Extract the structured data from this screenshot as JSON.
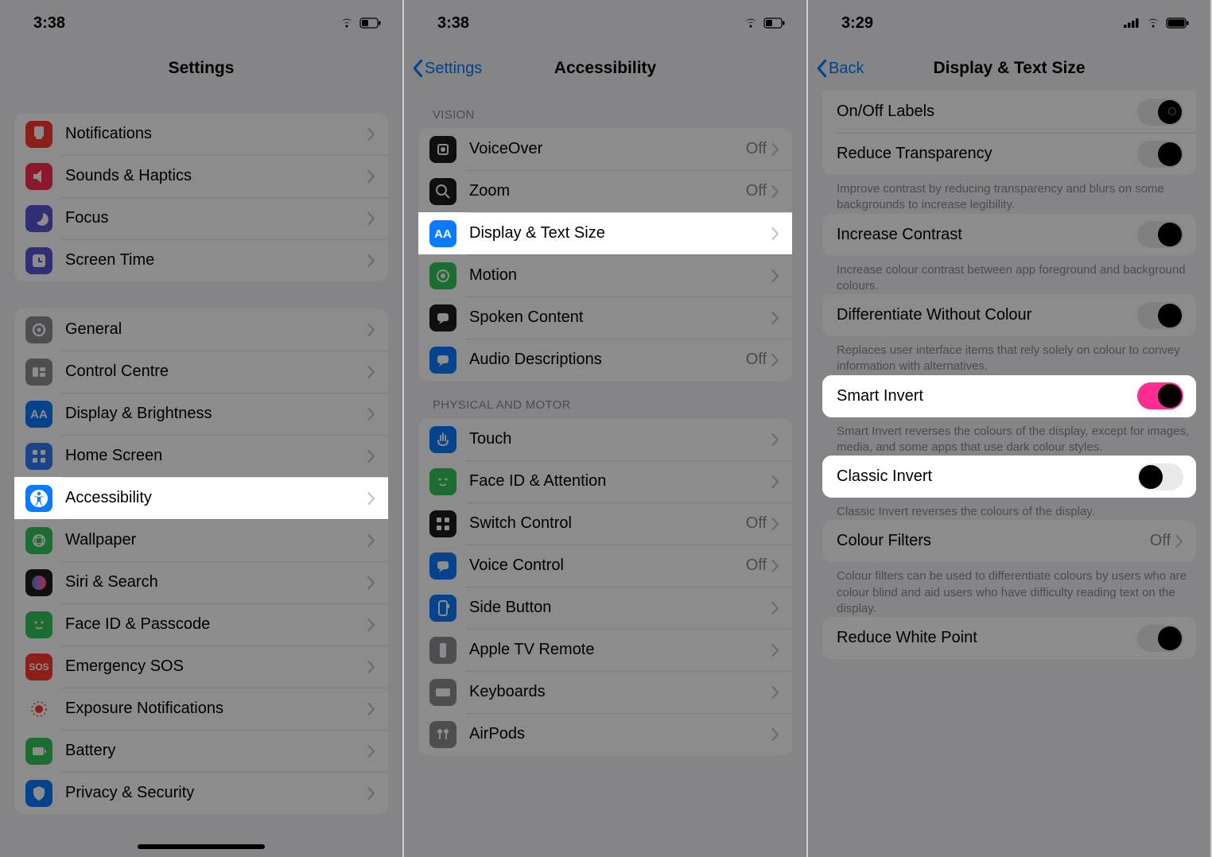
{
  "phone1": {
    "time": "3:38",
    "title": "Settings",
    "groups": [
      [
        {
          "icon": "notifications",
          "color": "#ff3a30",
          "label": "Notifications"
        },
        {
          "icon": "sounds",
          "color": "#ff2d55",
          "label": "Sounds & Haptics"
        },
        {
          "icon": "focus",
          "color": "#5856d6",
          "label": "Focus"
        },
        {
          "icon": "screentime",
          "color": "#5856d6",
          "label": "Screen Time"
        }
      ],
      [
        {
          "icon": "general",
          "color": "#8e8e93",
          "label": "General"
        },
        {
          "icon": "control",
          "color": "#8e8e93",
          "label": "Control Centre"
        },
        {
          "icon": "display",
          "color": "#0a7aff",
          "label": "Display & Brightness"
        },
        {
          "icon": "home",
          "color": "#3478f6",
          "label": "Home Screen"
        },
        {
          "icon": "accessibility",
          "color": "#0a7aff",
          "label": "Accessibility",
          "highlight": true
        },
        {
          "icon": "wallpaper",
          "color": "#34c759",
          "label": "Wallpaper"
        },
        {
          "icon": "siri",
          "color": "#1c1c1e",
          "label": "Siri & Search"
        },
        {
          "icon": "faceid",
          "color": "#34c759",
          "label": "Face ID & Passcode"
        },
        {
          "icon": "sos",
          "color": "#ff3a30",
          "label": "Emergency SOS"
        },
        {
          "icon": "exposure",
          "color": "#ffffff",
          "label": "Exposure Notifications",
          "dotcolor": "#ff3a30"
        },
        {
          "icon": "battery",
          "color": "#34c759",
          "label": "Battery"
        },
        {
          "icon": "privacy",
          "color": "#0a7aff",
          "label": "Privacy & Security"
        }
      ]
    ]
  },
  "phone2": {
    "time": "3:38",
    "back": "Settings",
    "title": "Accessibility",
    "sections": [
      {
        "header": "Vision",
        "rows": [
          {
            "icon": "voiceover",
            "color": "#1c1c1e",
            "label": "VoiceOver",
            "value": "Off"
          },
          {
            "icon": "zoom",
            "color": "#1c1c1e",
            "label": "Zoom",
            "value": "Off"
          },
          {
            "icon": "textsize",
            "color": "#0a7aff",
            "label": "Display & Text Size",
            "highlight": true
          },
          {
            "icon": "motion",
            "color": "#34c759",
            "label": "Motion"
          },
          {
            "icon": "spoken",
            "color": "#1c1c1e",
            "label": "Spoken Content"
          },
          {
            "icon": "audiodesc",
            "color": "#0a7aff",
            "label": "Audio Descriptions",
            "value": "Off"
          }
        ]
      },
      {
        "header": "Physical and Motor",
        "rows": [
          {
            "icon": "touch",
            "color": "#0a7aff",
            "label": "Touch"
          },
          {
            "icon": "faceatt",
            "color": "#34c759",
            "label": "Face ID & Attention"
          },
          {
            "icon": "switch",
            "color": "#1c1c1e",
            "label": "Switch Control",
            "value": "Off"
          },
          {
            "icon": "voicectl",
            "color": "#0a7aff",
            "label": "Voice Control",
            "value": "Off"
          },
          {
            "icon": "sidebtn",
            "color": "#0a7aff",
            "label": "Side Button"
          },
          {
            "icon": "appletv",
            "color": "#8e8e93",
            "label": "Apple TV Remote"
          },
          {
            "icon": "keyboards",
            "color": "#8e8e93",
            "label": "Keyboards"
          },
          {
            "icon": "airpods",
            "color": "#8e8e93",
            "label": "AirPods"
          }
        ]
      }
    ]
  },
  "phone3": {
    "time": "3:29",
    "back": "Back",
    "title": "Display & Text Size",
    "items": [
      {
        "type": "group",
        "rows": [
          {
            "label": "On/Off Labels",
            "toggle": "on-dim-ring"
          },
          {
            "label": "Reduce Transparency",
            "toggle": "on-dim"
          }
        ]
      },
      {
        "type": "footer",
        "text": "Improve contrast by reducing transparency and blurs on some backgrounds to increase legibility."
      },
      {
        "type": "group",
        "rows": [
          {
            "label": "Increase Contrast",
            "toggle": "on-dim"
          }
        ]
      },
      {
        "type": "footer",
        "text": "Increase colour contrast between app foreground and background colours."
      },
      {
        "type": "group",
        "rows": [
          {
            "label": "Differentiate Without Colour",
            "toggle": "on-dim"
          }
        ]
      },
      {
        "type": "footer",
        "text": "Replaces user interface items that rely solely on colour to convey information with alternatives."
      },
      {
        "type": "group",
        "highlight": true,
        "rows": [
          {
            "label": "Smart Invert",
            "toggle": "on-pink"
          }
        ]
      },
      {
        "type": "footer",
        "text": "Smart Invert reverses the colours of the display, except for images, media, and some apps that use dark colour styles."
      },
      {
        "type": "group",
        "highlight": true,
        "rows": [
          {
            "label": "Classic Invert",
            "toggle": "off"
          }
        ]
      },
      {
        "type": "footer",
        "text": "Classic Invert reverses the colours of the display."
      },
      {
        "type": "group",
        "rows": [
          {
            "label": "Colour Filters",
            "value": "Off",
            "chevron": true
          }
        ]
      },
      {
        "type": "footer",
        "text": "Colour filters can be used to differentiate colours by users who are colour blind and aid users who have difficulty reading text on the display."
      },
      {
        "type": "group",
        "rows": [
          {
            "label": "Reduce White Point",
            "toggle": "on-dim"
          }
        ]
      }
    ]
  }
}
